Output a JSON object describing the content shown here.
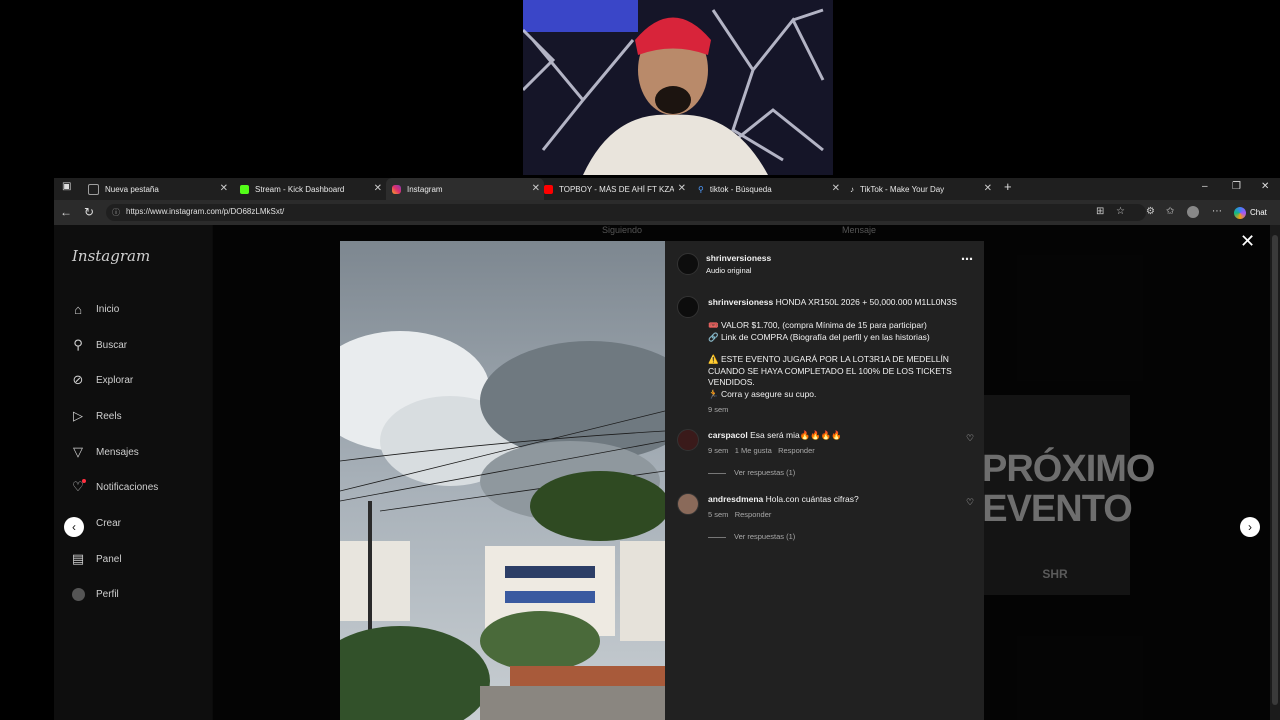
{
  "tabs": [
    {
      "label": "Nueva pestaña",
      "color": "#9e9e9e"
    },
    {
      "label": "Stream - Kick Dashboard",
      "color": "#53fc18"
    },
    {
      "label": "Instagram",
      "color": "#e1306c"
    },
    {
      "label": "TOPBOY - MÁS DE AHÍ FT KZADO",
      "color": "#ff0000"
    },
    {
      "label": "tiktok - Búsqueda",
      "color": "#4f9cff"
    },
    {
      "label": "TikTok - Make Your Day",
      "color": "#ffffff"
    }
  ],
  "address": {
    "url": "https://www.instagram.com/p/DO68zLMkSxt/"
  },
  "toolbar": {
    "chat_label": "Chat"
  },
  "instagram": {
    "logo": "Instagram",
    "nav": [
      {
        "label": "Inicio",
        "icon": "home-icon"
      },
      {
        "label": "Buscar",
        "icon": "search-icon"
      },
      {
        "label": "Explorar",
        "icon": "compass-icon"
      },
      {
        "label": "Reels",
        "icon": "reels-icon"
      },
      {
        "label": "Mensajes",
        "icon": "send-icon"
      },
      {
        "label": "Notificaciones",
        "icon": "heart-icon"
      },
      {
        "label": "Crear",
        "icon": "plus-icon"
      },
      {
        "label": "Panel",
        "icon": "chart-icon"
      },
      {
        "label": "Perfil",
        "icon": "avatar-icon"
      }
    ],
    "bg_buttons": {
      "following": "Siguiendo",
      "message": "Mensaje"
    },
    "promo": {
      "line1": "PRÓXIMO",
      "line2": "EVENTO",
      "brand": "SHR"
    }
  },
  "post": {
    "author": "shrinversioness",
    "audio": "Audio original",
    "caption": {
      "username": "shrinversioness",
      "title": "HONDA XR150L 2026 + 50,000.000 M1LL0N3S",
      "line1": "🎟️ VALOR $1.700, (compra Mínima de 15 para participar)",
      "line2": "🔗 Link de COMPRA (Biografía del perfil y en las historias)",
      "line3": "⚠️ ESTE EVENTO JUGARÁ POR LA LOT3R1A DE MEDELLÍN",
      "line4": "CUANDO SE HAYA COMPLETADO EL 100% DE LOS TICKETS",
      "line5": "VENDIDOS.",
      "line6": "🏃 Corra y asegure su cupo.",
      "time": "9 sem"
    },
    "comments": [
      {
        "username": "carspacol",
        "text": "Esa será mia🔥🔥🔥🔥",
        "time": "9 sem",
        "likes": "1 Me gusta",
        "reply": "Responder",
        "view_replies": "Ver respuestas (1)"
      },
      {
        "username": "andresdmena",
        "text": "Hola.con cuántas cifras?",
        "time": "5 sem",
        "reply": "Responder",
        "view_replies": "Ver respuestas (1)"
      }
    ]
  }
}
